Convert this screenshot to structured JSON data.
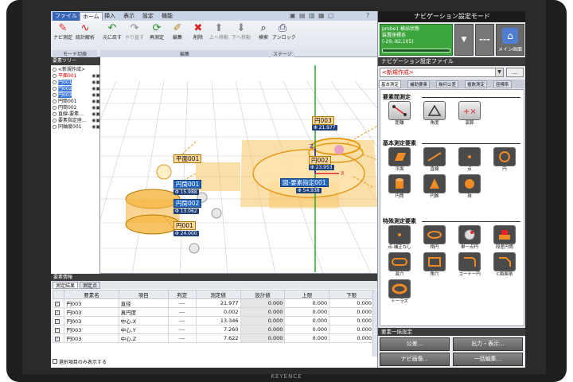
{
  "ribbon": {
    "file_tab": "ファイル ▾",
    "tabs": [
      "ホーム",
      "挿入",
      "表示",
      "設定",
      "機能"
    ],
    "buttons": [
      {
        "label": "ナビ測定",
        "icon": "✎"
      },
      {
        "label": "統計解析",
        "icon": "∿"
      },
      {
        "label": "元に戻す",
        "icon": "↶"
      },
      {
        "label": "やり直す",
        "icon": "↷"
      },
      {
        "label": "再測定",
        "icon": "⟳"
      },
      {
        "label": "編集",
        "icon": "✐"
      },
      {
        "label": "削除",
        "icon": "✖"
      },
      {
        "label": "上へ移動",
        "icon": "⬆"
      },
      {
        "label": "下へ移動",
        "icon": "⬇"
      },
      {
        "label": "検索",
        "icon": "⌕"
      },
      {
        "label": "アンロック",
        "icon": "⎙"
      }
    ],
    "groups": [
      "モード切換",
      "編集",
      "ステージ"
    ]
  },
  "tree": {
    "title": "要素ツリー",
    "items": [
      {
        "label": "<新規作成>",
        "style": "plain"
      },
      {
        "label": "平面001",
        "style": "red"
      },
      {
        "label": "円001",
        "style": "sel"
      },
      {
        "label": "円002",
        "style": "sel"
      },
      {
        "label": "円003",
        "style": "sel"
      },
      {
        "label": "円筒001",
        "style": "plain"
      },
      {
        "label": "円筒002",
        "style": "plain"
      },
      {
        "label": "直線-要素...",
        "style": "plain"
      },
      {
        "label": "要素指定座...",
        "style": "plain"
      },
      {
        "label": "同軸度001",
        "style": "plain"
      }
    ]
  },
  "viewport": {
    "labels": [
      {
        "text": "円003",
        "value": "Φ 21.977",
        "kind": "orange"
      },
      {
        "text": "円002",
        "value": "Φ 23.953",
        "kind": "orange"
      },
      {
        "text": "平面001",
        "value": "",
        "kind": "orange"
      },
      {
        "text": "円筒001",
        "value": "Φ 15.988",
        "kind": "blue"
      },
      {
        "text": "円筒002",
        "value": "Φ 13.062",
        "kind": "blue"
      },
      {
        "text": "円001",
        "value": "Φ 24.000",
        "kind": "orange"
      },
      {
        "text": "図-要素指定001",
        "value": "Φ 54.938",
        "kind": "blue"
      }
    ],
    "axis_x": "X",
    "axis_z": "Z"
  },
  "results": {
    "panel_title": "要素情報",
    "tabs": [
      "測定結果",
      "測定点"
    ],
    "headers": [
      "",
      "要素名",
      "項目",
      "判定",
      "測定値",
      "設計値",
      "上限",
      "下限"
    ],
    "rows": [
      {
        "name": "円003",
        "item": "直径",
        "judge": "---",
        "measured": "21.977",
        "design": "0.000",
        "upper": "0.000",
        "lower": "0.000"
      },
      {
        "name": "円003",
        "item": "真円度",
        "judge": "---",
        "measured": "0.002",
        "design": "0.000",
        "upper": "0.000",
        "lower": "0.000"
      },
      {
        "name": "円003",
        "item": "中心.X",
        "judge": "---",
        "measured": "13.346",
        "design": "0.000",
        "upper": "0.000",
        "lower": "0.000"
      },
      {
        "name": "円003",
        "item": "中心.Y",
        "judge": "---",
        "measured": "7.260",
        "design": "0.000",
        "upper": "0.000",
        "lower": "0.000"
      },
      {
        "name": "円003",
        "item": "中心.Z",
        "judge": "---",
        "measured": "7.622",
        "design": "0.000",
        "upper": "0.000",
        "lower": "0.000"
      }
    ],
    "footer": "選択項目のみ表示する"
  },
  "right": {
    "title": "ナビゲーション設定モード",
    "probe": {
      "line1": "probe1 検出状態",
      "line2": "装置座標系",
      "line3": "(-29,-82,105)"
    },
    "dash": "---",
    "main_label": "メイン画面",
    "navfile_title": "ナビゲーション設定ファイル",
    "navfile_value": "<新規作成>",
    "navfile_more": "...",
    "tabs": [
      "基本測定",
      "補助要素",
      "幾何公差",
      "複数測定",
      "座標系"
    ],
    "sections": [
      {
        "title": "要素間測定",
        "items": [
          "距離",
          "角度",
          "演算"
        ]
      },
      {
        "title": "基本測定要素",
        "items": [
          "平面",
          "直線",
          "点",
          "円",
          "円筒",
          "円錐",
          "球"
        ]
      },
      {
        "title": "特殊測定要素",
        "items": [
          "点-補正なし",
          "楕円",
          "単一点円",
          "段差円筒",
          "長穴",
          "角穴",
          "コーナー円",
          "C面面積",
          "トーラス"
        ]
      }
    ],
    "batch_title": "要素一括設定",
    "batch_buttons": [
      "公差...",
      "出力・表示...",
      "ナビ画像...",
      "一括編集..."
    ]
  },
  "brand": "KEYENCE"
}
